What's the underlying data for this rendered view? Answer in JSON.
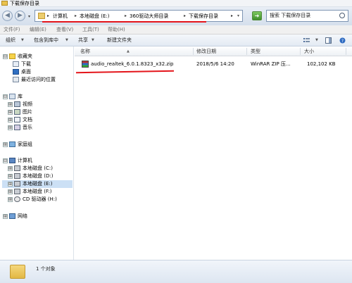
{
  "window": {
    "title": "下载保存目录"
  },
  "navigation": {
    "back_glyph": "◀",
    "forward_glyph": "▶",
    "address": {
      "separator": "▸",
      "crumbs": [
        "计算机",
        "本地磁盘 (E:)",
        "360驱动大师目录",
        "下载保存目录"
      ],
      "dropdown_glyph": "▾"
    },
    "refresh_glyph": "➜",
    "search_placeholder": "搜索 下载保存目录"
  },
  "menubar": {
    "items": [
      "文件(F)",
      "编辑(E)",
      "查看(V)",
      "工具(T)",
      "帮助(H)"
    ]
  },
  "toolbar": {
    "organize": "组织",
    "include_in_library": "包含到库中",
    "share": "共享",
    "new_folder": "新建文件夹",
    "dropdown_glyph": "▼"
  },
  "sidebar": {
    "expand_glyph": "⊟",
    "collapse_glyph": "⊞",
    "favorites": {
      "label": "收藏夹",
      "items": [
        "下载",
        "桌面",
        "最近访问的位置"
      ]
    },
    "libraries": {
      "label": "库",
      "items": [
        "视频",
        "图片",
        "文档",
        "音乐"
      ]
    },
    "homegroup": {
      "label": "家庭组"
    },
    "computer": {
      "label": "计算机",
      "items": [
        "本地磁盘 (C:)",
        "本地磁盘 (D:)",
        "本地磁盘 (E:)",
        "本地磁盘 (F:)",
        "CD 驱动器 (H:)"
      ]
    },
    "network": {
      "label": "网络"
    }
  },
  "columns": {
    "name": "名称",
    "date": "修改日期",
    "type": "类型",
    "size": "大小",
    "sort_glyph": "▲"
  },
  "files": [
    {
      "name": "audio_realtek_6.0.1.8323_x32.zip",
      "date": "2018/5/6 14:20",
      "type": "WinRAR ZIP 压...",
      "size": "102,102 KB"
    }
  ],
  "status": {
    "count_text": "1 个对象"
  },
  "colors": {
    "highlight_red": "#e4151b",
    "selection": "#cce0f5"
  }
}
